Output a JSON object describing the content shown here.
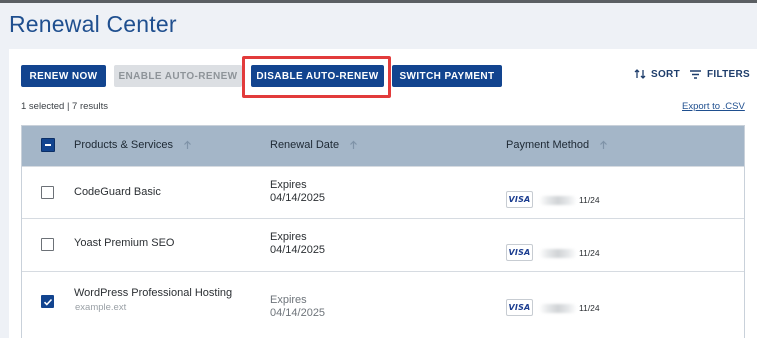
{
  "page": {
    "title": "Renewal Center"
  },
  "toolbar": {
    "renew_now": "RENEW NOW",
    "enable_auto_renew": "ENABLE AUTO-RENEW",
    "disable_auto_renew": "DISABLE AUTO-RENEW",
    "switch_payment": "SWITCH PAYMENT",
    "sort": "SORT",
    "filters": "FILTERS"
  },
  "summary": {
    "text": "1 selected | 7 results",
    "export_label": "Export to .CSV"
  },
  "table": {
    "columns": [
      "Products & Services",
      "Renewal Date",
      "Payment Method"
    ],
    "rows": [
      {
        "product": "CodeGuard Basic",
        "domain": "",
        "renewal_label": "Expires",
        "renewal_date": "04/14/2025",
        "card_brand": "VISA",
        "card_expiry": "11/24",
        "selected": false
      },
      {
        "product": "Yoast Premium SEO",
        "domain": "",
        "renewal_label": "Expires",
        "renewal_date": "04/14/2025",
        "card_brand": "VISA",
        "card_expiry": "11/24",
        "selected": false
      },
      {
        "product": "WordPress Professional Hosting",
        "domain": "example.ext",
        "renewal_label": "Expires",
        "renewal_date": "04/14/2025",
        "card_brand": "VISA",
        "card_expiry": "11/24",
        "selected": true
      }
    ]
  },
  "colors": {
    "primary": "#12448f",
    "title": "#1f4f8f",
    "header_bg": "#a4b6c8",
    "highlight": "#e23b3b",
    "disabled_bg": "#dcdfe3"
  },
  "icons": {
    "sort": "sort-arrows-icon",
    "filters": "filter-lines-icon",
    "column_sort": "arrow-up-icon",
    "check": "checkmark-icon"
  }
}
